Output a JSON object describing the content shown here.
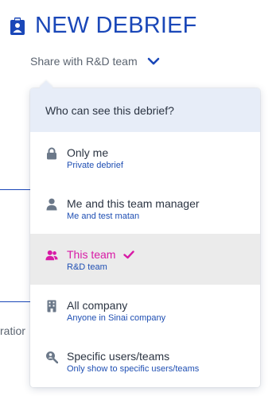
{
  "header": {
    "title": "NEW DEBRIEF",
    "icon": "badge-icon"
  },
  "share": {
    "label": "Share with R&D team",
    "chevron_icon": "chevron-down-icon"
  },
  "background": {
    "partial_text": "ratior"
  },
  "dropdown": {
    "title": "Who can see this debrief?",
    "options": [
      {
        "title": "Only me",
        "subtitle": "Private debrief",
        "icon": "lock-icon",
        "selected": false
      },
      {
        "title": "Me and this team manager",
        "subtitle": "Me and test matan",
        "icon": "user-icon",
        "selected": false
      },
      {
        "title": "This team",
        "subtitle": "R&D team",
        "icon": "users-icon",
        "selected": true
      },
      {
        "title": "All company",
        "subtitle": "Anyone in Sinai company",
        "icon": "building-icon",
        "selected": false
      },
      {
        "title": "Specific users/teams",
        "subtitle": "Only show to specific users/teams",
        "icon": "search-user-icon",
        "selected": false
      }
    ]
  },
  "colors": {
    "brand_blue": "#1a47b8",
    "selected_magenta": "#d81ba6",
    "icon_gray": "#6b7889",
    "header_bg": "#e7edf8",
    "selected_bg": "#ebebeb"
  }
}
